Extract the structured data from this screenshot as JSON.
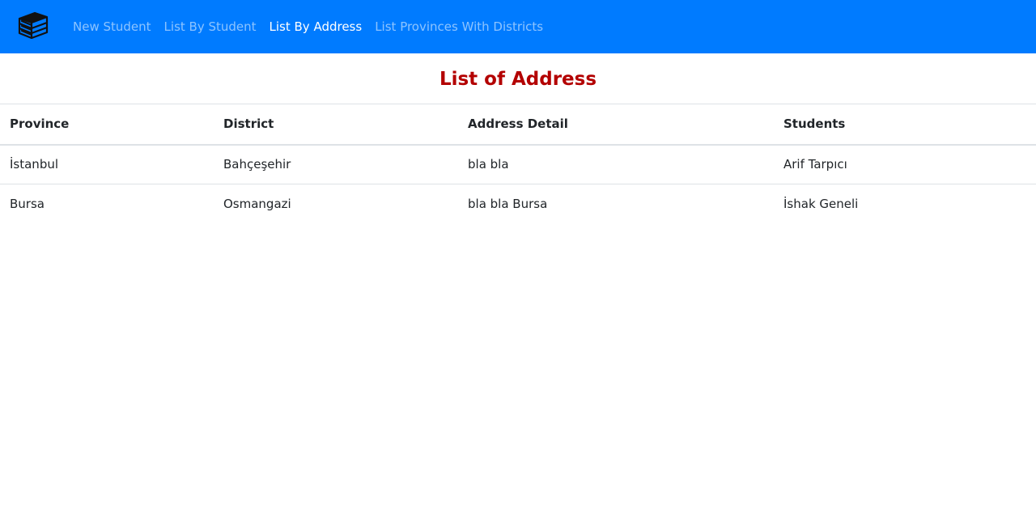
{
  "navbar": {
    "brand_icon": "books-stack-icon",
    "colors": {
      "background": "#007bff",
      "link": "rgba(255,255,255,0.55)",
      "active_link": "#ffffff"
    },
    "links": [
      {
        "label": "New Student",
        "active": false
      },
      {
        "label": "List By Student",
        "active": false
      },
      {
        "label": "List By Address",
        "active": true
      },
      {
        "label": "List Provinces With Districts",
        "active": false
      }
    ]
  },
  "main": {
    "title": "List of Address",
    "title_color": "#b30000",
    "table": {
      "headers": [
        "Province",
        "District",
        "Address Detail",
        "Students"
      ],
      "rows": [
        [
          "İstanbul",
          "Bahçeşehir",
          "bla bla",
          "Arif Tarpıcı"
        ],
        [
          "Bursa",
          "Osmangazi",
          "bla bla Bursa",
          "İshak Geneli"
        ]
      ]
    }
  }
}
